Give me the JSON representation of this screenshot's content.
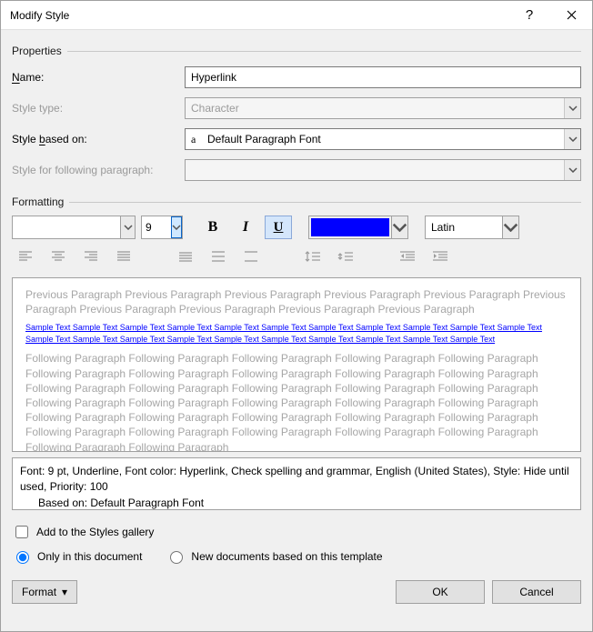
{
  "title": "Modify Style",
  "groups": {
    "properties": "Properties",
    "formatting": "Formatting"
  },
  "labels": {
    "name": "ame:",
    "name_u": "N",
    "style_type": "Style type:",
    "based_on": "Style ",
    "based_on_u": "b",
    "based_on2": "ased on:",
    "following": "Style for following paragraph:"
  },
  "fields": {
    "name_value": "Hyperlink",
    "style_type_value": "Character",
    "based_on_value": "Default Paragraph Font",
    "following_value": ""
  },
  "format": {
    "font_name": "",
    "font_size": "9",
    "color": "#0000ff",
    "lang": "Latin"
  },
  "preview": {
    "prev_line": "Previous Paragraph Previous Paragraph Previous Paragraph Previous Paragraph Previous Paragraph Previous Paragraph Previous Paragraph Previous Paragraph Previous Paragraph Previous Paragraph",
    "sample": "Sample Text Sample Text Sample Text Sample Text Sample Text Sample Text Sample Text Sample Text Sample Text Sample Text Sample Text Sample Text Sample Text Sample Text Sample Text Sample Text Sample Text Sample Text Sample Text Sample Text Sample Text",
    "follow_line": "Following Paragraph Following Paragraph Following Paragraph Following Paragraph Following Paragraph Following Paragraph Following Paragraph Following Paragraph Following Paragraph Following Paragraph Following Paragraph Following Paragraph Following Paragraph Following Paragraph Following Paragraph Following Paragraph Following Paragraph Following Paragraph Following Paragraph Following Paragraph Following Paragraph Following Paragraph Following Paragraph Following Paragraph Following Paragraph Following Paragraph Following Paragraph Following Paragraph Following Paragraph Following Paragraph Following Paragraph Following Paragraph"
  },
  "description": {
    "line1": "Font: 9 pt, Underline, Font color: Hyperlink, Check spelling and grammar, English (United States), Style: Hide until used, Priority: 100",
    "line2": "Based on: Default Paragraph Font"
  },
  "checks": {
    "add_gallery_pre": "Add to the ",
    "add_gallery_u": "S",
    "add_gallery_post": "tyles gallery",
    "only_doc": "Only in this ",
    "only_doc_u": "d",
    "only_doc_post": "ocument",
    "new_docs": "New documents based on this template"
  },
  "buttons": {
    "format_pre": "F",
    "format_u": "o",
    "format_post": "rmat",
    "ok": "OK",
    "cancel": "Cancel"
  }
}
